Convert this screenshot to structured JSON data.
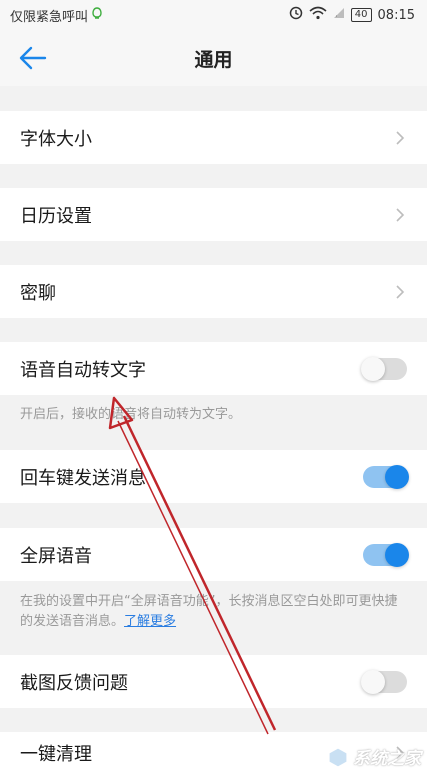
{
  "status_bar": {
    "carrier": "仅限紧急呼叫",
    "battery": "40",
    "time": "08:15"
  },
  "header": {
    "title": "通用"
  },
  "rows": [
    {
      "label": "字体大小",
      "control": "chevron"
    },
    {
      "label": "日历设置",
      "control": "chevron"
    },
    {
      "label": "密聊",
      "control": "chevron"
    },
    {
      "label": "语音自动转文字",
      "control": "toggle",
      "on": false
    },
    {
      "label": "回车键发送消息",
      "control": "toggle",
      "on": true
    },
    {
      "label": "全屏语音",
      "control": "toggle",
      "on": true
    },
    {
      "label": "截图反馈问题",
      "control": "toggle",
      "on": false
    },
    {
      "label": "一键清理",
      "control": "chevron"
    }
  ],
  "hints": {
    "voice_to_text": "开启后，接收的语音将自动转为文字。",
    "fullscreen_voice_text": "在我的设置中开启“全屏语音功能”，长按消息区空白处即可更快捷的发送语音消息。",
    "fullscreen_voice_link": "了解更多"
  },
  "watermark": {
    "text": "系统之家"
  },
  "colors": {
    "accent": "#1a86ea",
    "toggle_on_track": "#8fc3f1",
    "annotation_arrow": "#c0262b"
  }
}
